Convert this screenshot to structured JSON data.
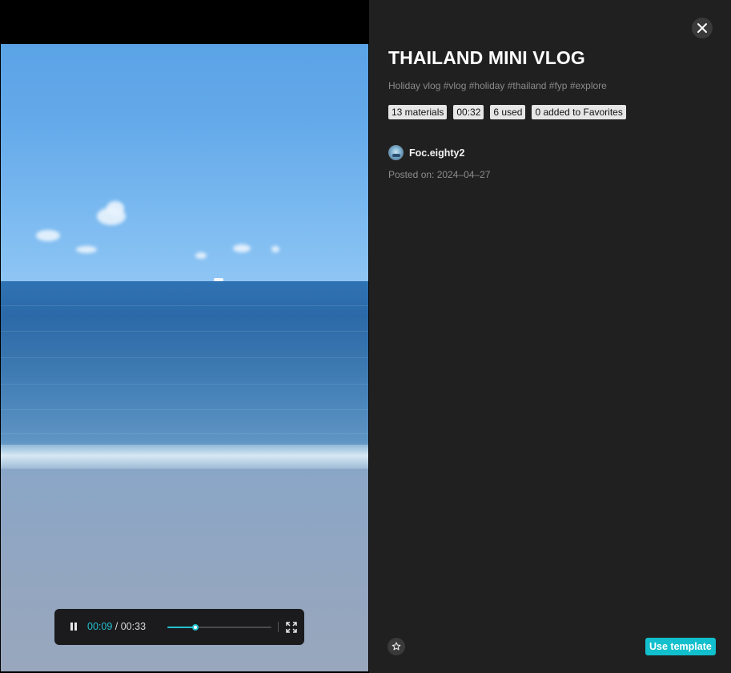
{
  "template": {
    "title": "THAILAND MINI VLOG",
    "description": "Holiday vlog #vlog #holiday #thailand #fyp #explore",
    "badges": [
      "13 materials",
      "00:32",
      "6 used",
      "0 added to Favorites"
    ],
    "author": "Foc.eighty2",
    "posted": "Posted on: 2024–04–27"
  },
  "player": {
    "current_time": "00:09",
    "separator": "/",
    "duration": "00:33",
    "progress": 0.27
  },
  "actions": {
    "use_template": "Use template"
  },
  "icons": {
    "close": "close-icon",
    "pause": "pause-icon",
    "fullscreen": "fullscreen-icon",
    "favorite": "star-icon"
  },
  "colors": {
    "accent": "#12bfcc",
    "panel_bg": "#202020"
  }
}
